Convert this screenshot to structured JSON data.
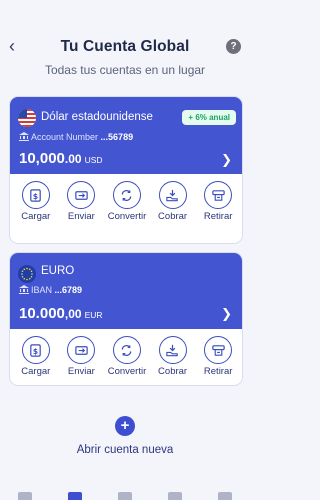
{
  "header": {
    "title": "Tu Cuenta Global",
    "subtitle": "Todas tus cuentas en un lugar",
    "help_label": "?"
  },
  "cards": [
    {
      "currency_name": "Dólar estadounidense",
      "badge": "+ 6% anual",
      "account_label": "Account Number",
      "account_number": "...56789",
      "balance_main": "10,000",
      "balance_cents": ".00",
      "currency_code": "USD",
      "flag": "us-flag-icon"
    },
    {
      "currency_name": "EURO",
      "account_label": "IBAN",
      "account_number": "...6789",
      "balance_main": "10.000",
      "balance_cents": ",00",
      "currency_code": "EUR",
      "flag": "eu-flag-icon"
    }
  ],
  "actions": [
    {
      "label": "Cargar",
      "icon": "dollar-add-icon"
    },
    {
      "label": "Enviar",
      "icon": "send-money-icon"
    },
    {
      "label": "Convertir",
      "icon": "convert-icon"
    },
    {
      "label": "Cobrar",
      "icon": "receive-money-icon"
    },
    {
      "label": "Retirar",
      "icon": "withdraw-icon"
    }
  ],
  "new_account": {
    "label": "Abrir cuenta nueva",
    "icon": "plus-icon"
  },
  "bottom_nav": [
    "home-icon",
    "card-icon",
    "transfer-icon",
    "wallet-icon",
    "gift-icon"
  ],
  "colors": {
    "primary": "#4355d0",
    "badge_bg": "#e6fbef",
    "badge_text": "#1aa368",
    "background": "#f4f5fb"
  }
}
